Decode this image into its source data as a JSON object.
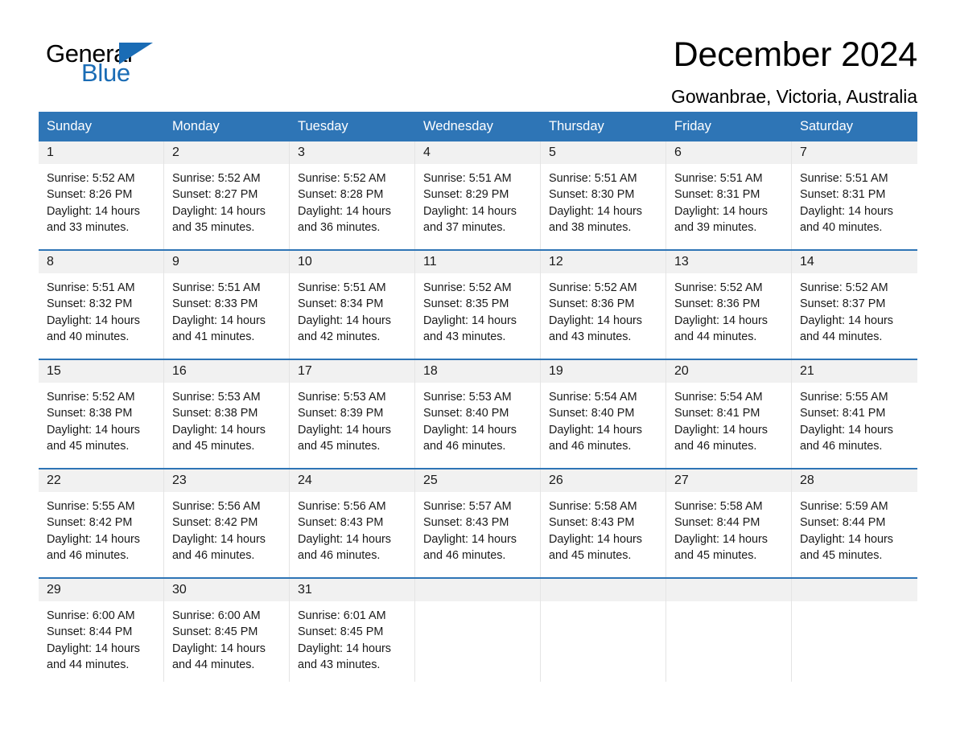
{
  "logo": {
    "word_one": "General",
    "word_two": "Blue",
    "triangle_icon": "triangle-icon",
    "brand_color": "#1a6cb5"
  },
  "header": {
    "title": "December 2024",
    "subtitle": "Gowanbrae, Victoria, Australia"
  },
  "theme": {
    "header_blue": "#2e75b6",
    "day_band_gray": "#f1f1f1",
    "row_divider": "#2e75b6",
    "column_divider": "#e4e4e4"
  },
  "calendar": {
    "weekdays": [
      "Sunday",
      "Monday",
      "Tuesday",
      "Wednesday",
      "Thursday",
      "Friday",
      "Saturday"
    ],
    "weeks": [
      [
        {
          "day": "1",
          "sunrise": "Sunrise: 5:52 AM",
          "sunset": "Sunset: 8:26 PM",
          "daylight_line1": "Daylight: 14 hours",
          "daylight_line2": "and 33 minutes."
        },
        {
          "day": "2",
          "sunrise": "Sunrise: 5:52 AM",
          "sunset": "Sunset: 8:27 PM",
          "daylight_line1": "Daylight: 14 hours",
          "daylight_line2": "and 35 minutes."
        },
        {
          "day": "3",
          "sunrise": "Sunrise: 5:52 AM",
          "sunset": "Sunset: 8:28 PM",
          "daylight_line1": "Daylight: 14 hours",
          "daylight_line2": "and 36 minutes."
        },
        {
          "day": "4",
          "sunrise": "Sunrise: 5:51 AM",
          "sunset": "Sunset: 8:29 PM",
          "daylight_line1": "Daylight: 14 hours",
          "daylight_line2": "and 37 minutes."
        },
        {
          "day": "5",
          "sunrise": "Sunrise: 5:51 AM",
          "sunset": "Sunset: 8:30 PM",
          "daylight_line1": "Daylight: 14 hours",
          "daylight_line2": "and 38 minutes."
        },
        {
          "day": "6",
          "sunrise": "Sunrise: 5:51 AM",
          "sunset": "Sunset: 8:31 PM",
          "daylight_line1": "Daylight: 14 hours",
          "daylight_line2": "and 39 minutes."
        },
        {
          "day": "7",
          "sunrise": "Sunrise: 5:51 AM",
          "sunset": "Sunset: 8:31 PM",
          "daylight_line1": "Daylight: 14 hours",
          "daylight_line2": "and 40 minutes."
        }
      ],
      [
        {
          "day": "8",
          "sunrise": "Sunrise: 5:51 AM",
          "sunset": "Sunset: 8:32 PM",
          "daylight_line1": "Daylight: 14 hours",
          "daylight_line2": "and 40 minutes."
        },
        {
          "day": "9",
          "sunrise": "Sunrise: 5:51 AM",
          "sunset": "Sunset: 8:33 PM",
          "daylight_line1": "Daylight: 14 hours",
          "daylight_line2": "and 41 minutes."
        },
        {
          "day": "10",
          "sunrise": "Sunrise: 5:51 AM",
          "sunset": "Sunset: 8:34 PM",
          "daylight_line1": "Daylight: 14 hours",
          "daylight_line2": "and 42 minutes."
        },
        {
          "day": "11",
          "sunrise": "Sunrise: 5:52 AM",
          "sunset": "Sunset: 8:35 PM",
          "daylight_line1": "Daylight: 14 hours",
          "daylight_line2": "and 43 minutes."
        },
        {
          "day": "12",
          "sunrise": "Sunrise: 5:52 AM",
          "sunset": "Sunset: 8:36 PM",
          "daylight_line1": "Daylight: 14 hours",
          "daylight_line2": "and 43 minutes."
        },
        {
          "day": "13",
          "sunrise": "Sunrise: 5:52 AM",
          "sunset": "Sunset: 8:36 PM",
          "daylight_line1": "Daylight: 14 hours",
          "daylight_line2": "and 44 minutes."
        },
        {
          "day": "14",
          "sunrise": "Sunrise: 5:52 AM",
          "sunset": "Sunset: 8:37 PM",
          "daylight_line1": "Daylight: 14 hours",
          "daylight_line2": "and 44 minutes."
        }
      ],
      [
        {
          "day": "15",
          "sunrise": "Sunrise: 5:52 AM",
          "sunset": "Sunset: 8:38 PM",
          "daylight_line1": "Daylight: 14 hours",
          "daylight_line2": "and 45 minutes."
        },
        {
          "day": "16",
          "sunrise": "Sunrise: 5:53 AM",
          "sunset": "Sunset: 8:38 PM",
          "daylight_line1": "Daylight: 14 hours",
          "daylight_line2": "and 45 minutes."
        },
        {
          "day": "17",
          "sunrise": "Sunrise: 5:53 AM",
          "sunset": "Sunset: 8:39 PM",
          "daylight_line1": "Daylight: 14 hours",
          "daylight_line2": "and 45 minutes."
        },
        {
          "day": "18",
          "sunrise": "Sunrise: 5:53 AM",
          "sunset": "Sunset: 8:40 PM",
          "daylight_line1": "Daylight: 14 hours",
          "daylight_line2": "and 46 minutes."
        },
        {
          "day": "19",
          "sunrise": "Sunrise: 5:54 AM",
          "sunset": "Sunset: 8:40 PM",
          "daylight_line1": "Daylight: 14 hours",
          "daylight_line2": "and 46 minutes."
        },
        {
          "day": "20",
          "sunrise": "Sunrise: 5:54 AM",
          "sunset": "Sunset: 8:41 PM",
          "daylight_line1": "Daylight: 14 hours",
          "daylight_line2": "and 46 minutes."
        },
        {
          "day": "21",
          "sunrise": "Sunrise: 5:55 AM",
          "sunset": "Sunset: 8:41 PM",
          "daylight_line1": "Daylight: 14 hours",
          "daylight_line2": "and 46 minutes."
        }
      ],
      [
        {
          "day": "22",
          "sunrise": "Sunrise: 5:55 AM",
          "sunset": "Sunset: 8:42 PM",
          "daylight_line1": "Daylight: 14 hours",
          "daylight_line2": "and 46 minutes."
        },
        {
          "day": "23",
          "sunrise": "Sunrise: 5:56 AM",
          "sunset": "Sunset: 8:42 PM",
          "daylight_line1": "Daylight: 14 hours",
          "daylight_line2": "and 46 minutes."
        },
        {
          "day": "24",
          "sunrise": "Sunrise: 5:56 AM",
          "sunset": "Sunset: 8:43 PM",
          "daylight_line1": "Daylight: 14 hours",
          "daylight_line2": "and 46 minutes."
        },
        {
          "day": "25",
          "sunrise": "Sunrise: 5:57 AM",
          "sunset": "Sunset: 8:43 PM",
          "daylight_line1": "Daylight: 14 hours",
          "daylight_line2": "and 46 minutes."
        },
        {
          "day": "26",
          "sunrise": "Sunrise: 5:58 AM",
          "sunset": "Sunset: 8:43 PM",
          "daylight_line1": "Daylight: 14 hours",
          "daylight_line2": "and 45 minutes."
        },
        {
          "day": "27",
          "sunrise": "Sunrise: 5:58 AM",
          "sunset": "Sunset: 8:44 PM",
          "daylight_line1": "Daylight: 14 hours",
          "daylight_line2": "and 45 minutes."
        },
        {
          "day": "28",
          "sunrise": "Sunrise: 5:59 AM",
          "sunset": "Sunset: 8:44 PM",
          "daylight_line1": "Daylight: 14 hours",
          "daylight_line2": "and 45 minutes."
        }
      ],
      [
        {
          "day": "29",
          "sunrise": "Sunrise: 6:00 AM",
          "sunset": "Sunset: 8:44 PM",
          "daylight_line1": "Daylight: 14 hours",
          "daylight_line2": "and 44 minutes."
        },
        {
          "day": "30",
          "sunrise": "Sunrise: 6:00 AM",
          "sunset": "Sunset: 8:45 PM",
          "daylight_line1": "Daylight: 14 hours",
          "daylight_line2": "and 44 minutes."
        },
        {
          "day": "31",
          "sunrise": "Sunrise: 6:01 AM",
          "sunset": "Sunset: 8:45 PM",
          "daylight_line1": "Daylight: 14 hours",
          "daylight_line2": "and 43 minutes."
        },
        {
          "day": "",
          "sunrise": "",
          "sunset": "",
          "daylight_line1": "",
          "daylight_line2": ""
        },
        {
          "day": "",
          "sunrise": "",
          "sunset": "",
          "daylight_line1": "",
          "daylight_line2": ""
        },
        {
          "day": "",
          "sunrise": "",
          "sunset": "",
          "daylight_line1": "",
          "daylight_line2": ""
        },
        {
          "day": "",
          "sunrise": "",
          "sunset": "",
          "daylight_line1": "",
          "daylight_line2": ""
        }
      ]
    ]
  }
}
